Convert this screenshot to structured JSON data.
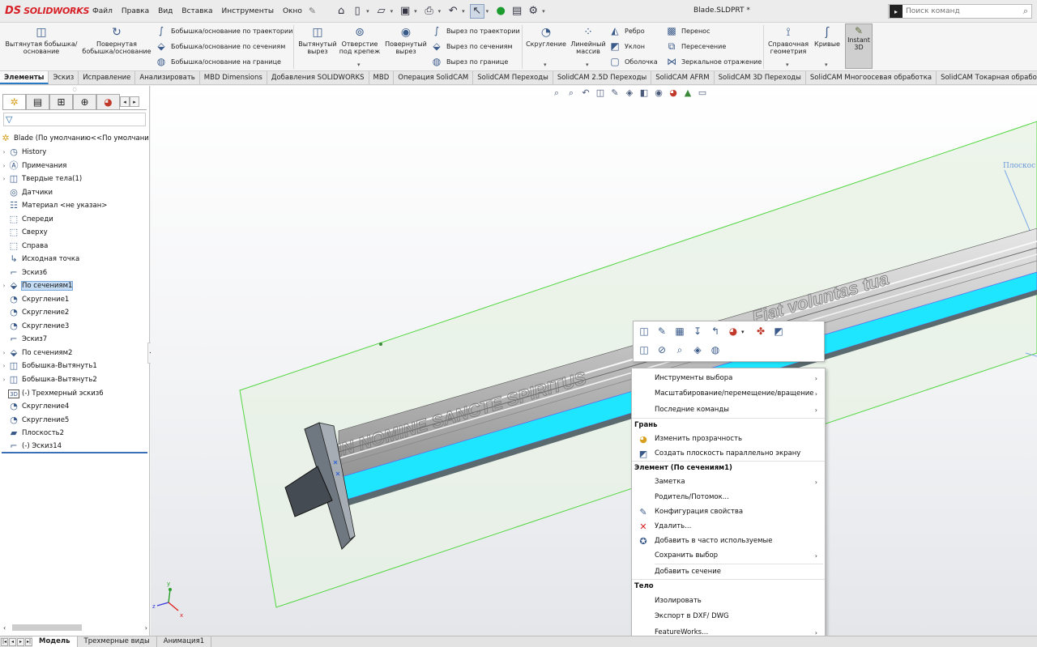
{
  "app": {
    "brand_ds": "DS",
    "brand_name": "SOLIDWORKS",
    "doc_title": "Blade.SLDPRT *"
  },
  "menu": [
    "Файл",
    "Правка",
    "Вид",
    "Вставка",
    "Инструменты",
    "Окно"
  ],
  "search": {
    "placeholder": "Поиск команд"
  },
  "ribbon": {
    "extruded_boss": "Вытянутая бобышка/основание",
    "revolved_boss": "Повернутая бобышка/основание",
    "swept_boss": "Бобышка/основание по траектории",
    "lofted_boss": "Бобышка/основание по сечениям",
    "boundary_boss": "Бобышка/основание на границе",
    "extruded_cut": "Вытянутый вырез",
    "hole_wizard": "Отверстие под крепеж",
    "revolved_cut": "Повернутый вырез",
    "swept_cut": "Вырез по траектории",
    "lofted_cut": "Вырез по сечениям",
    "boundary_cut": "Вырез по границе",
    "fillet": "Скругление",
    "linear_pattern": "Линейный массив",
    "rib": "Ребро",
    "draft": "Уклон",
    "shell": "Оболочка",
    "wrap": "Перенос",
    "intersect": "Пересечение",
    "mirror": "Зеркальное отражение",
    "ref_geometry": "Справочная геометрия",
    "curves": "Кривые",
    "instant3d": "Instant 3D"
  },
  "tabs": [
    "Элементы",
    "Эскиз",
    "Исправление",
    "Анализировать",
    "MBD Dimensions",
    "Добавления SOLIDWORKS",
    "MBD",
    "Операция SolidCAM",
    "SolidCAM Переходы",
    "SolidCAM 2.5D Переходы",
    "SolidCAM AFRM",
    "SolidCAM 3D Переходы",
    "SolidCAM Многоосевая обработка",
    "SolidCAM Токарная обработка"
  ],
  "tree": [
    {
      "label": "Blade  (По умолчанию<<По умолчани",
      "icon": "part-icon",
      "expand": ""
    },
    {
      "label": "History",
      "icon": "history-icon",
      "expand": "›"
    },
    {
      "label": "Примечания",
      "icon": "annotations-icon",
      "expand": "›"
    },
    {
      "label": "Твердые тела(1)",
      "icon": "solid-bodies-icon",
      "expand": "›"
    },
    {
      "label": "Датчики",
      "icon": "sensors-icon",
      "expand": ""
    },
    {
      "label": "Материал <не указан>",
      "icon": "material-icon",
      "expand": ""
    },
    {
      "label": "Спереди",
      "icon": "plane-icon",
      "expand": ""
    },
    {
      "label": "Сверху",
      "icon": "plane-icon",
      "expand": ""
    },
    {
      "label": "Справа",
      "icon": "plane-icon",
      "expand": ""
    },
    {
      "label": "Исходная точка",
      "icon": "origin-icon",
      "expand": ""
    },
    {
      "label": "Эскиз6",
      "icon": "sketch-icon",
      "expand": ""
    },
    {
      "label": "По сечениям1",
      "icon": "loft-icon",
      "expand": "›"
    },
    {
      "label": "Скругление1",
      "icon": "fillet-icon",
      "expand": ""
    },
    {
      "label": "Скругление2",
      "icon": "fillet-icon",
      "expand": ""
    },
    {
      "label": "Скругление3",
      "icon": "fillet-icon",
      "expand": ""
    },
    {
      "label": "Эскиз7",
      "icon": "sketch-icon",
      "expand": ""
    },
    {
      "label": "По сечениям2",
      "icon": "loft-icon",
      "expand": "›"
    },
    {
      "label": "Бобышка-Вытянуть1",
      "icon": "extrude-icon",
      "expand": "›"
    },
    {
      "label": "Бобышка-Вытянуть2",
      "icon": "extrude-icon",
      "expand": "›"
    },
    {
      "label": "(-) Трехмерный эскиз6",
      "icon": "3d-sketch-icon",
      "expand": ""
    },
    {
      "label": "Скругление4",
      "icon": "fillet-icon",
      "expand": ""
    },
    {
      "label": "Скругление5",
      "icon": "fillet-icon",
      "expand": ""
    },
    {
      "label": "Плоскость2",
      "icon": "plane-feature-icon",
      "expand": ""
    },
    {
      "label": "(-) Эскиз14",
      "icon": "sketch-icon",
      "expand": ""
    }
  ],
  "viewport": {
    "engraving_1": "IN NOMINE SANCTE SPIRITUS",
    "engraving_2": "Fiat voluntas tua",
    "plane_label": "Плоскос"
  },
  "context_menu": {
    "select_tools": "Инструменты выбора",
    "zoom_pan_rotate": "Масштабирование/перемещение/вращение",
    "recent_commands": "Последние команды",
    "header_face": "Грань",
    "change_transparency": "Изменить прозрачность",
    "create_plane_parallel": "Создать плоскость параллельно экрану",
    "header_feature": "Элемент (По сечениям1)",
    "note": "Заметка",
    "parent_child": "Родитель/Потомок...",
    "configure_feature": "Конфигурация свойства",
    "delete": "Удалить...",
    "add_favorites": "Добавить в часто используемые",
    "save_selection": "Сохранить выбор",
    "add_section": "Добавить сечение",
    "header_body": "Тело",
    "isolate": "Изолировать",
    "export_dxf": "Экспорт в DXF/ DWG",
    "featureworks": "FeatureWorks..."
  },
  "bottom_tabs": [
    "Модель",
    "Трехмерные виды",
    "Анимация1"
  ],
  "triad": {
    "x": "x",
    "y": "y",
    "z": "z"
  },
  "colors": {
    "accent": "#2a79c4",
    "blade_highlight": "#1ee6ff",
    "plane_green": "#7bd96b",
    "delete_red": "#d81f1f"
  }
}
